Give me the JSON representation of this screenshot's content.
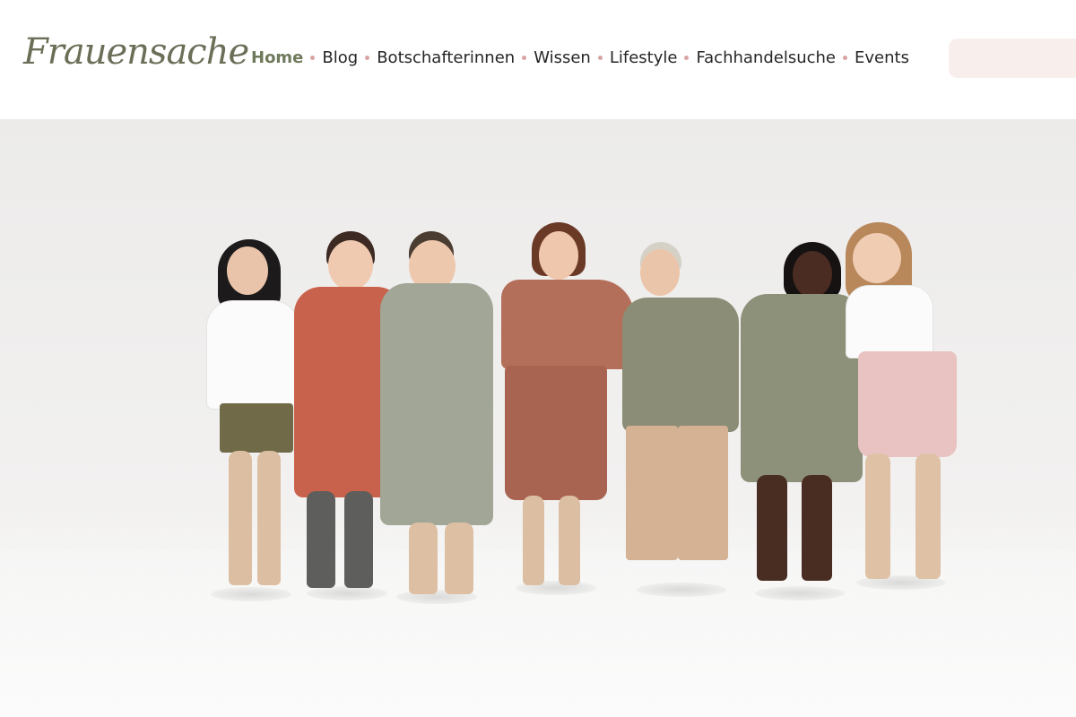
{
  "header": {
    "logo": "Frauensache",
    "nav": [
      {
        "label": "Home",
        "active": true
      },
      {
        "label": "Blog",
        "active": false
      },
      {
        "label": "Botschafterinnen",
        "active": false
      },
      {
        "label": "Wissen",
        "active": false
      },
      {
        "label": "Lifestyle",
        "active": false
      },
      {
        "label": "Fachhandelsuche",
        "active": false
      },
      {
        "label": "Events",
        "active": false
      }
    ],
    "search": {
      "placeholder": ""
    }
  },
  "colors": {
    "logo": "#6b6f58",
    "nav_active": "#6f7a5c",
    "nav_dot": "#d9a3a3",
    "search_bg": "#f8efed"
  },
  "hero": {
    "image_description_icon": "group-photo-image"
  }
}
